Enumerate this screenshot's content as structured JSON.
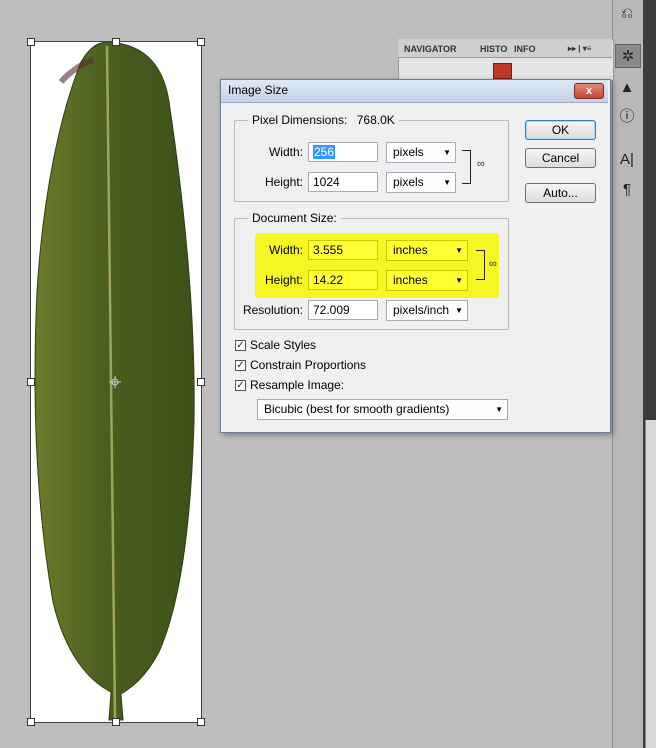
{
  "dialog": {
    "title": "Image Size",
    "close_glyph": "x",
    "pixel_dimensions": {
      "legend": "Pixel Dimensions:",
      "size": "768.0K",
      "width_label": "Width:",
      "width_value": "256",
      "width_unit": "pixels",
      "height_label": "Height:",
      "height_value": "1024",
      "height_unit": "pixels"
    },
    "document_size": {
      "legend": "Document Size:",
      "width_label": "Width:",
      "width_value": "3.555",
      "width_unit": "inches",
      "height_label": "Height:",
      "height_value": "14.22",
      "height_unit": "inches",
      "resolution_label": "Resolution:",
      "resolution_value": "72.009",
      "resolution_unit": "pixels/inch"
    },
    "checkboxes": {
      "scale_styles": {
        "label": "Scale Styles",
        "checked": true
      },
      "constrain": {
        "label": "Constrain Proportions",
        "checked": true
      },
      "resample": {
        "label": "Resample Image:",
        "checked": true
      }
    },
    "resample_method": "Bicubic (best for smooth gradients)",
    "buttons": {
      "ok": "OK",
      "cancel": "Cancel",
      "auto": "Auto..."
    },
    "highlight_color": "#f6f623"
  },
  "navigator": {
    "tabs": [
      "NAVIGATOR",
      "HISTO",
      "INFO"
    ]
  },
  "icons": [
    "history-icon",
    "navigator-icon",
    "histogram-icon",
    "info-icon",
    "character-icon",
    "paragraph-icon"
  ],
  "colors": {
    "leaf": "#4a5e1f",
    "canvas": "#bebebe"
  }
}
